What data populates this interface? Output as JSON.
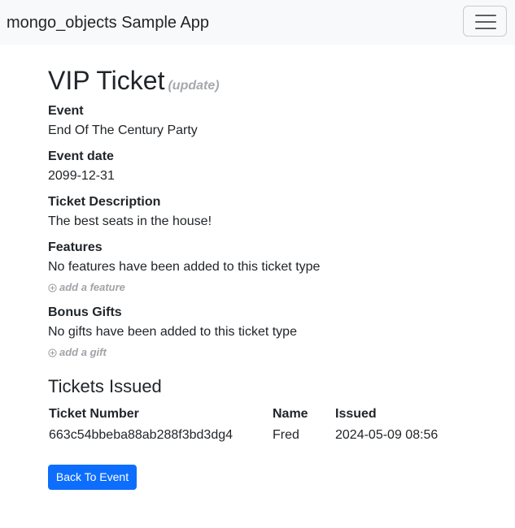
{
  "navbar": {
    "brand": "mongo_objects Sample App",
    "toggler_icon": "hamburger-menu-icon"
  },
  "ticket": {
    "title": "VIP Ticket",
    "update_link": "(update)",
    "fields": {
      "event_label": "Event",
      "event_value": "End Of The Century Party",
      "date_label": "Event date",
      "date_value": "2099-12-31",
      "description_label": "Ticket Description",
      "description_value": "The best seats in the house!",
      "features_label": "Features",
      "features_value": "No features have been added to this ticket type",
      "add_feature": "add a feature",
      "gifts_label": "Bonus Gifts",
      "gifts_value": "No gifts have been added to this ticket type",
      "add_gift": "add a gift"
    }
  },
  "tickets_issued": {
    "title": "Tickets Issued",
    "columns": [
      "Ticket Number",
      "Name",
      "Issued"
    ],
    "rows": [
      [
        "663c54bbeba88ab288f3bd3dg4",
        "Fred",
        "2024-05-09 08:56"
      ]
    ]
  },
  "actions": {
    "back_button": "Back To Event"
  },
  "colors": {
    "navbar_bg": "#f8f9fa",
    "primary": "#0d6efd",
    "muted_link": "#a0a3a7",
    "text": "#212529"
  }
}
